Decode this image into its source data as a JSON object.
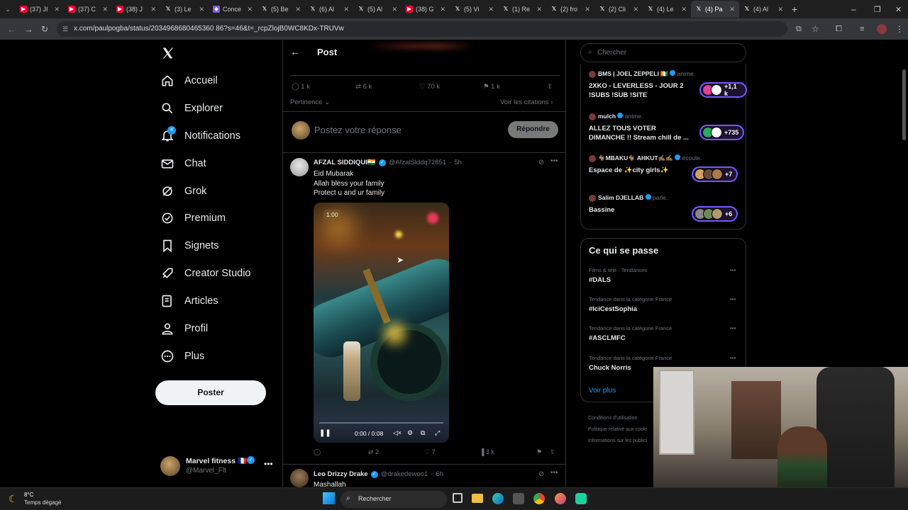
{
  "browser": {
    "tabs": [
      {
        "label": "(37) JI",
        "icon": "youtube-icon"
      },
      {
        "label": "(37) C",
        "icon": "youtube-icon"
      },
      {
        "label": "(38) J",
        "icon": "youtube-icon"
      },
      {
        "label": "(3) Le",
        "icon": "x-logo-icon"
      },
      {
        "label": "Conce",
        "icon": "purple-app-icon"
      },
      {
        "label": "(5) Be",
        "icon": "x-logo-icon"
      },
      {
        "label": "(6) Al",
        "icon": "x-logo-icon"
      },
      {
        "label": "(5) Al",
        "icon": "x-logo-icon"
      },
      {
        "label": "(38) G",
        "icon": "youtube-icon"
      },
      {
        "label": "(5) Vi",
        "icon": "x-logo-icon"
      },
      {
        "label": "(1) Re",
        "icon": "x-logo-icon"
      },
      {
        "label": "(2) fro",
        "icon": "x-logo-icon"
      },
      {
        "label": "(2) Cli",
        "icon": "x-logo-icon"
      },
      {
        "label": "(4) Le",
        "icon": "x-logo-icon"
      },
      {
        "label": "(4) Pa",
        "icon": "x-logo-icon",
        "active": true
      },
      {
        "label": "(4) Al",
        "icon": "x-logo-icon"
      }
    ],
    "url": "x.com/paulpogba/status/2034968680465360 86?s=46&t=_rcpZlojB0WC8KDx-TRUVw"
  },
  "nav": {
    "items": [
      "Accueil",
      "Explorer",
      "Notifications",
      "Chat",
      "Grok",
      "Premium",
      "Signets",
      "Creator Studio",
      "Articles",
      "Profil",
      "Plus"
    ],
    "notif_badge": "4",
    "post_button": "Poster",
    "account": {
      "name": "Marvel fitness 🇫🇷",
      "handle": "@Marvel_Flt"
    }
  },
  "post": {
    "header": "Post",
    "stats": {
      "replies": "1 k",
      "reposts": "6 k",
      "likes": "70 k",
      "bookmarks": "1 k"
    },
    "sort": "Pertinence",
    "quotes": "Voir les citations",
    "reply_placeholder": "Postez votre réponse",
    "reply_button": "Répondre"
  },
  "replies": [
    {
      "name": "AFZAL SIDDIQUI🇮🇳",
      "handle": "@AfzalSlddq72851",
      "time": "5h",
      "lines": [
        "Eid Mubarak",
        "Allah bless your family",
        "Protect u and ur family"
      ],
      "video": {
        "badge": "1:00",
        "time": "0:00 / 0:08"
      },
      "stats": {
        "replies": "",
        "reposts": "2",
        "likes": "7",
        "views": "3 k"
      }
    },
    {
      "name": "Leo Drizzy Drake",
      "handle": "@drakedewoo1",
      "time": "6h",
      "lines": [
        "Mashallah"
      ]
    }
  ],
  "search_placeholder": "Chercher",
  "spaces": [
    {
      "host": "BMS | JOEL ZEPPELI 🇨🇮",
      "verb": "anime.",
      "title": [
        "2XKO - LEVERLESS - JOUR 2",
        "!SUBS !SUB !SITE"
      ],
      "count": "+1,1 k"
    },
    {
      "host": "mulch",
      "verb": "anime.",
      "title": [
        "ALLEZ TOUS VOTER",
        "DIMANCHE !! Stream chill de ..."
      ],
      "count": "+735"
    },
    {
      "host": "🐐MBAKU🐐 AHKUT✍🏾✍🏾",
      "verb": "écoute.",
      "title": [
        "Espace de ✨city girls✨"
      ],
      "count": "+7"
    },
    {
      "host": "Salim DJELLAB",
      "verb": "parle.",
      "title": [
        "Bassine"
      ],
      "count": "+6"
    }
  ],
  "trends": {
    "title": "Ce qui se passe",
    "items": [
      {
        "context": "Films & télé · Tendances",
        "name": "#DALS"
      },
      {
        "context": "Tendance dans la catégorie France",
        "name": "#IciCestSophia"
      },
      {
        "context": "Tendance dans la catégorie France",
        "name": "#ASCLMFC"
      },
      {
        "context": "Tendance dans la catégorie France",
        "name": "Chuck Norris"
      }
    ],
    "more": "Voir plus"
  },
  "footer_links": [
    "Conditions d'utilisation",
    "Politique relative aux cooki",
    "Informations sur les publici"
  ],
  "taskbar": {
    "temp": "8°C",
    "weather": "Temps dégagé",
    "search": "Rechercher"
  },
  "colors": {
    "accent": "#1d9bf0",
    "space": "#7856ff"
  }
}
